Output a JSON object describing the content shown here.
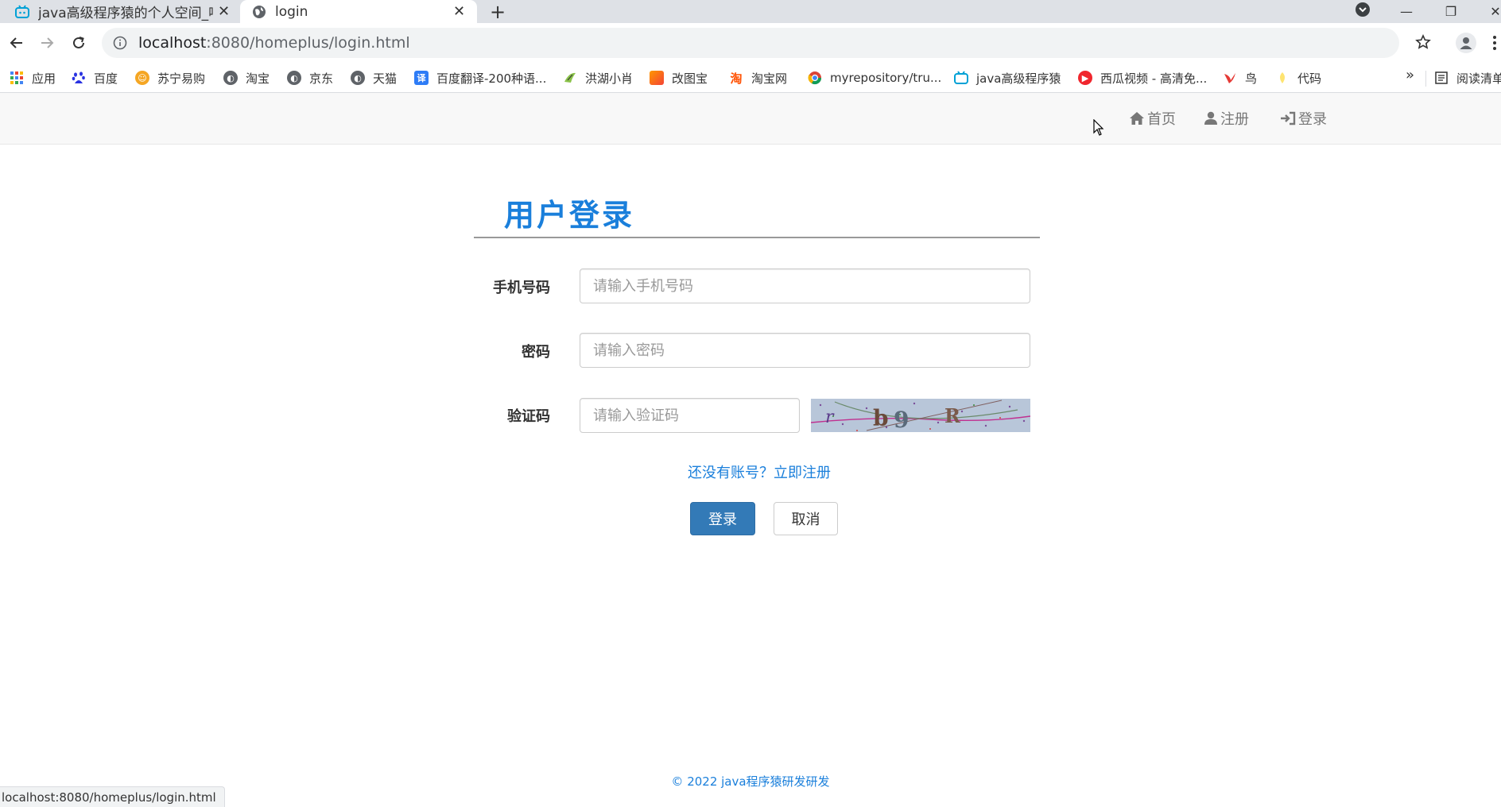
{
  "browser": {
    "tabs": [
      {
        "title": "java高级程序猿的个人空间_哔哩",
        "active": false
      },
      {
        "title": "login",
        "active": true
      }
    ],
    "url_host": "localhost",
    "url_path": ":8080/homeplus/login.html",
    "bookmarks": [
      {
        "label": "应用",
        "icon": "apps-grid-icon",
        "color": "#4285f4"
      },
      {
        "label": "百度",
        "icon": "baidu-paw-icon",
        "color": "#2932e1"
      },
      {
        "label": "苏宁易购",
        "icon": "suning-lion-icon",
        "color": "#f5a623"
      },
      {
        "label": "淘宝",
        "icon": "globe-icon",
        "color": "#5f6368"
      },
      {
        "label": "京东",
        "icon": "globe-icon",
        "color": "#5f6368"
      },
      {
        "label": "天猫",
        "icon": "globe-icon",
        "color": "#5f6368"
      },
      {
        "label": "百度翻译-200种语...",
        "icon": "translate-icon",
        "color": "#2e7cf6"
      },
      {
        "label": "洪湖小肖",
        "icon": "bird-icon",
        "color": "#8bc34a"
      },
      {
        "label": "改图宝",
        "icon": "image-tool-icon",
        "color": "#ff5722"
      },
      {
        "label": "淘宝网",
        "icon": "taobao-icon",
        "color": "#ff5000"
      },
      {
        "label": "myrepository/tru...",
        "icon": "chrome-icon",
        "color": "#db4437"
      },
      {
        "label": "java高级程序猿",
        "icon": "bilibili-icon",
        "color": "#00a1d6"
      },
      {
        "label": "西瓜视频 - 高清免...",
        "icon": "xigua-icon",
        "color": "#f0262d"
      },
      {
        "label": "鸟",
        "icon": "bird-red-icon",
        "color": "#e53935"
      },
      {
        "label": "代码",
        "icon": "code-leaf-icon",
        "color": "#fdd835"
      }
    ],
    "bookmarks_more": "»",
    "reading_list": "阅读清单",
    "status_url": "localhost:8080/homeplus/login.html"
  },
  "nav": {
    "home": "首页",
    "register": "注册",
    "login": "登录"
  },
  "form": {
    "heading": "用户登录",
    "phone_label": "手机号码",
    "phone_placeholder": "请输入手机号码",
    "password_label": "密码",
    "password_placeholder": "请输入密码",
    "captcha_label": "验证码",
    "captcha_placeholder": "请输入验证码",
    "captcha_text": "r b9 R",
    "register_prompt": "还没有账号？立即注册",
    "submit": "登录",
    "cancel": "取消"
  },
  "footer": {
    "copyright": "© 2022 java程序猿研发研发"
  },
  "colors": {
    "accent": "#1a7fdb",
    "primary_button": "#337ab7",
    "navbar_bg": "#f8f8f8"
  }
}
